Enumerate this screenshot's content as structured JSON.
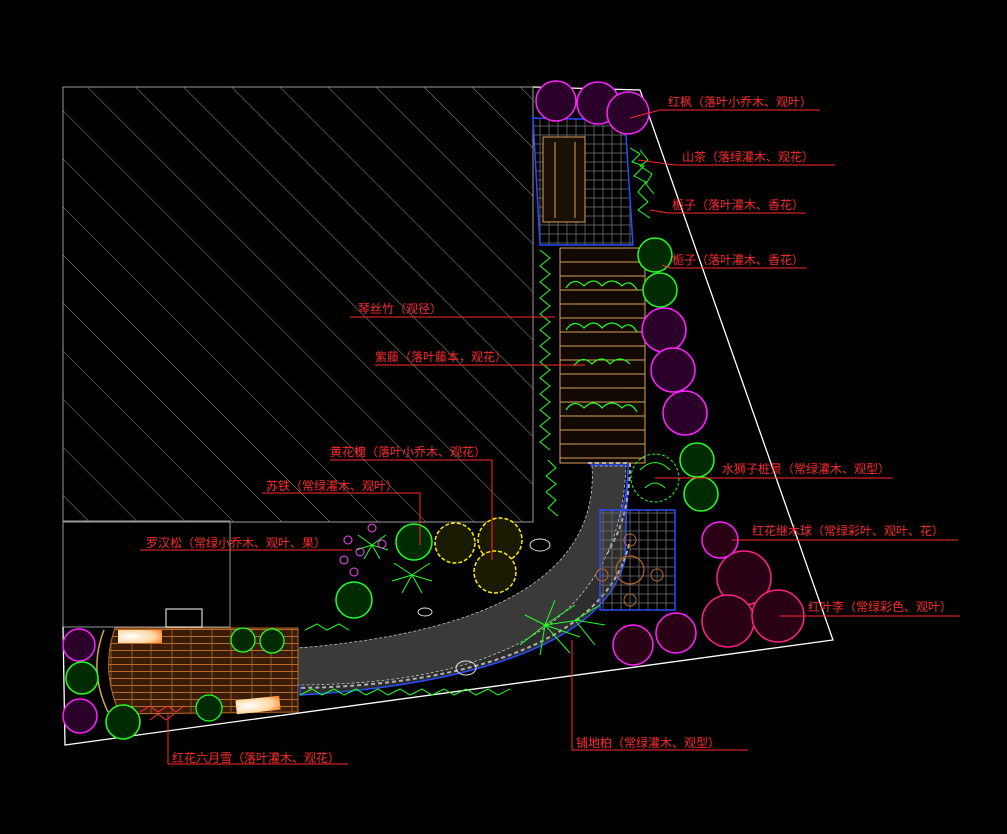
{
  "drawing": {
    "background": "#000000",
    "colors": {
      "label": "#ff2a2a",
      "outline": "#ffffff",
      "building_hatch": "#9a9a9a",
      "path_blue": "#2a4bff",
      "paving_grid": "#7a7a7a",
      "boardwalk": "#d8a05a",
      "deck": "#b86a2a",
      "pebble": "#b0b0b0",
      "green": "#22ff22",
      "magenta": "#ff22ff",
      "pink": "#ff2288",
      "red": "#ff3030",
      "yellow": "#ffee00"
    },
    "labels": {
      "hongfeng": "红枫（落叶小乔木、观叶）",
      "shancha": "山茶（落绿灌木、观花）",
      "zhizi_1": "栀子（落叶灌木、香花）",
      "zhizi_2": "栀子（落叶灌木、香花）",
      "qinsizhu": "琴丝竹（观径）",
      "ziteng": "紫藤（落叶藤本，观花）",
      "huanghuahuai": "黄花槐（落叶小乔木、观花）",
      "sutie": "苏铁（常绿灌木、观叶）",
      "luohansong": "罗汉松（常绿小乔木、观叶、果）",
      "shuishizi": "水狮子桩景（常绿灌木、观型）",
      "hongjimu": "红花继木球（常绿彩叶、观叶、花）",
      "hongyeli": "红叶李（常绿彩色、观叶）",
      "liuyuexue": "红花六月雪（落叶灌木、观花）",
      "pudibai": "铺地柏（常绿灌木、观型）"
    }
  }
}
